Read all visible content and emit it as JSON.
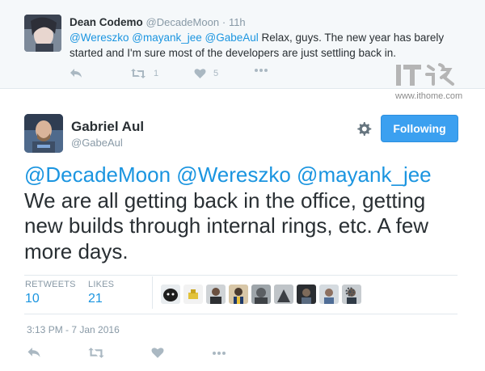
{
  "reply_tweet": {
    "name": "Dean Codemo",
    "handle": "@DecadeMoon",
    "separator": "·",
    "time": "11h",
    "mentions": [
      "@Wereszko",
      "@mayank_jee",
      "@GabeAul"
    ],
    "text_line1": "Relax, guys. The new year has barely",
    "text_line2": "started and I'm sure most of the developers are just settling back in.",
    "retweet_count": "1",
    "like_count": "5",
    "icons": [
      "reply-icon",
      "retweet-icon",
      "like-icon",
      "more-icon"
    ]
  },
  "watermark": {
    "logo_text": "IT之家",
    "url": "www.ithome.com"
  },
  "main_tweet": {
    "name": "Gabriel Aul",
    "handle": "@GabeAul",
    "follow_button": "Following",
    "mentions": [
      "@DecadeMoon",
      "@Wereszko",
      "@mayank_jee"
    ],
    "text_line1": "We are all getting back in the office, getting",
    "text_line2": "new builds through internal rings, etc. A few",
    "text_line3": "more days.",
    "retweets_label": "RETWEETS",
    "retweets_value": "10",
    "likes_label": "LIKES",
    "likes_value": "21",
    "timestamp": "3:13 PM - 7 Jan 2016",
    "icons": [
      "reply-icon",
      "retweet-icon",
      "like-icon",
      "more-icon"
    ]
  },
  "colors": {
    "link": "#1b95e0",
    "follow_button": "#3ba0f0",
    "muted": "#8899a6",
    "text": "#292f33",
    "reply_background": "#f5f8fa"
  }
}
